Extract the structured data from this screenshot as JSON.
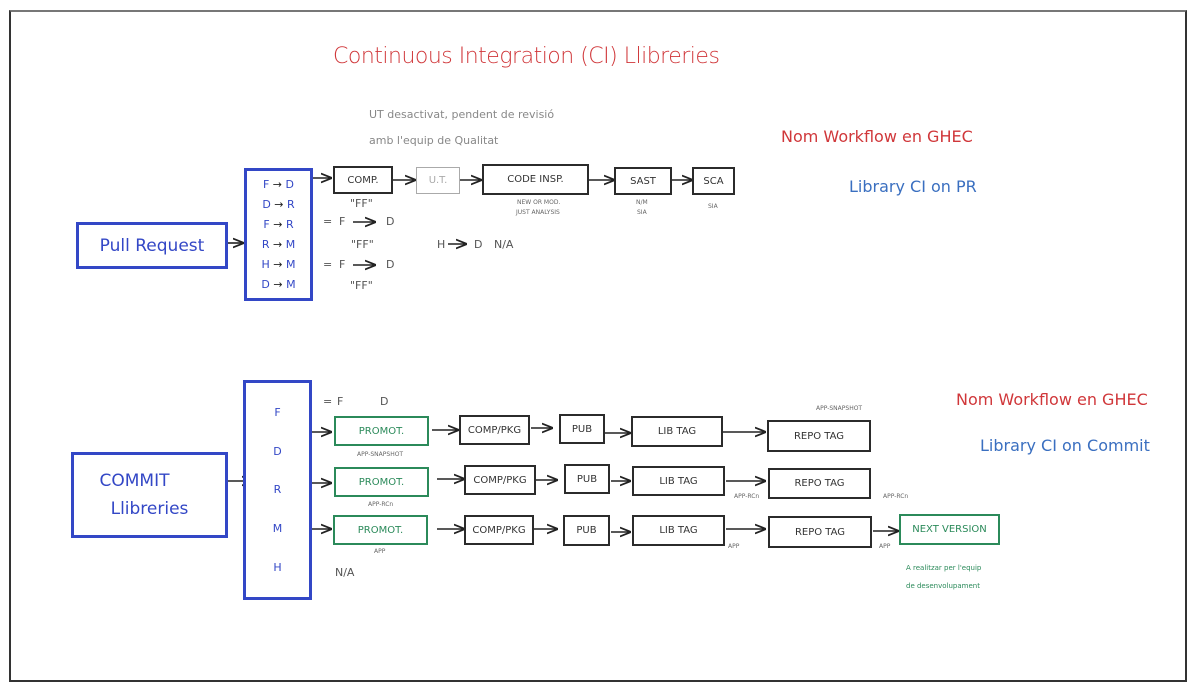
{
  "title": "Continuous Integration (CI) Llibreries",
  "ut_note": [
    "UT desactivat, pendent de revisió",
    "amb l'equip de Qualitat"
  ],
  "pr_section": {
    "workflow_label": "Nom Workflow en GHEC",
    "workflow_name": "Library CI on PR",
    "trigger": "Pull Request",
    "branches": [
      {
        "from": "F",
        "to": "D"
      },
      {
        "from": "D",
        "to": "R"
      },
      {
        "from": "F",
        "to": "R"
      },
      {
        "from": "R",
        "to": "M"
      },
      {
        "from": "H",
        "to": "M"
      },
      {
        "from": "D",
        "to": "M"
      }
    ],
    "steps": [
      {
        "label": "COMP.",
        "style": "normal",
        "notes": []
      },
      {
        "label": "U.T.",
        "style": "disabled",
        "notes": []
      },
      {
        "label": "CODE INSP.",
        "style": "normal",
        "notes": [
          "NEW OR MOD.",
          "JUST ANALYSIS"
        ]
      },
      {
        "label": "SAST",
        "style": "normal",
        "notes": [
          "N/M",
          "SIA"
        ]
      },
      {
        "label": "SCA",
        "style": "normal",
        "notes": [
          "SIA"
        ]
      }
    ],
    "annotations": {
      "ff1": "\"FF\"",
      "eq1": {
        "eq": "=",
        "from": "F",
        "to": "D"
      },
      "ff2": "\"FF\"",
      "eq2": {
        "eq": "=",
        "from": "F",
        "to": "D"
      },
      "ff3": "\"FF\"",
      "hd": {
        "from": "H",
        "to": "D",
        "note": "N/A"
      }
    }
  },
  "commit_section": {
    "workflow_label": "Nom Workflow en GHEC",
    "workflow_name": "Library CI on Commit",
    "trigger": [
      "COMMIT",
      "Llibreries"
    ],
    "branches": [
      "F",
      "D",
      "R",
      "M",
      "H"
    ],
    "f_eq_d": {
      "eq": "=",
      "from": "F",
      "to": "D"
    },
    "h_note": "N/A",
    "rows": [
      {
        "promote": "PROMOT.",
        "promote_note": "APP-SNAPSHOT",
        "comp": "COMP/PKG",
        "pub": "PUB",
        "lib_tag": "LIB TAG",
        "lib_tag_note": "",
        "repo_tag": "REPO TAG",
        "repo_tag_note": "APP-SNAPSHOT",
        "after_repo_note": ""
      },
      {
        "promote": "PROMOT.",
        "promote_note": "APP-RCn",
        "comp": "COMP/PKG",
        "pub": "PUB",
        "lib_tag": "LIB TAG",
        "lib_tag_note": "APP-RCn",
        "repo_tag": "REPO TAG",
        "repo_tag_note": "",
        "after_repo_note": "APP-RCn"
      },
      {
        "promote": "PROMOT.",
        "promote_note": "APP",
        "comp": "COMP/PKG",
        "pub": "PUB",
        "lib_tag": "LIB TAG",
        "lib_tag_note": "APP",
        "repo_tag": "REPO TAG",
        "repo_tag_note": "",
        "after_repo_note": "APP"
      }
    ],
    "next_version": "NEXT VERSION",
    "next_version_note": [
      "A realitzar per l'equip",
      "de desenvolupament"
    ]
  },
  "colors": {
    "title_red": "#d0373a",
    "workflow_blue": "#3a6fc0",
    "branch_blue": "#3347c6",
    "promote_green": "#2b8a5a",
    "stroke_dark": "#2b2b2b",
    "disabled_grey": "#aaaaaa"
  }
}
